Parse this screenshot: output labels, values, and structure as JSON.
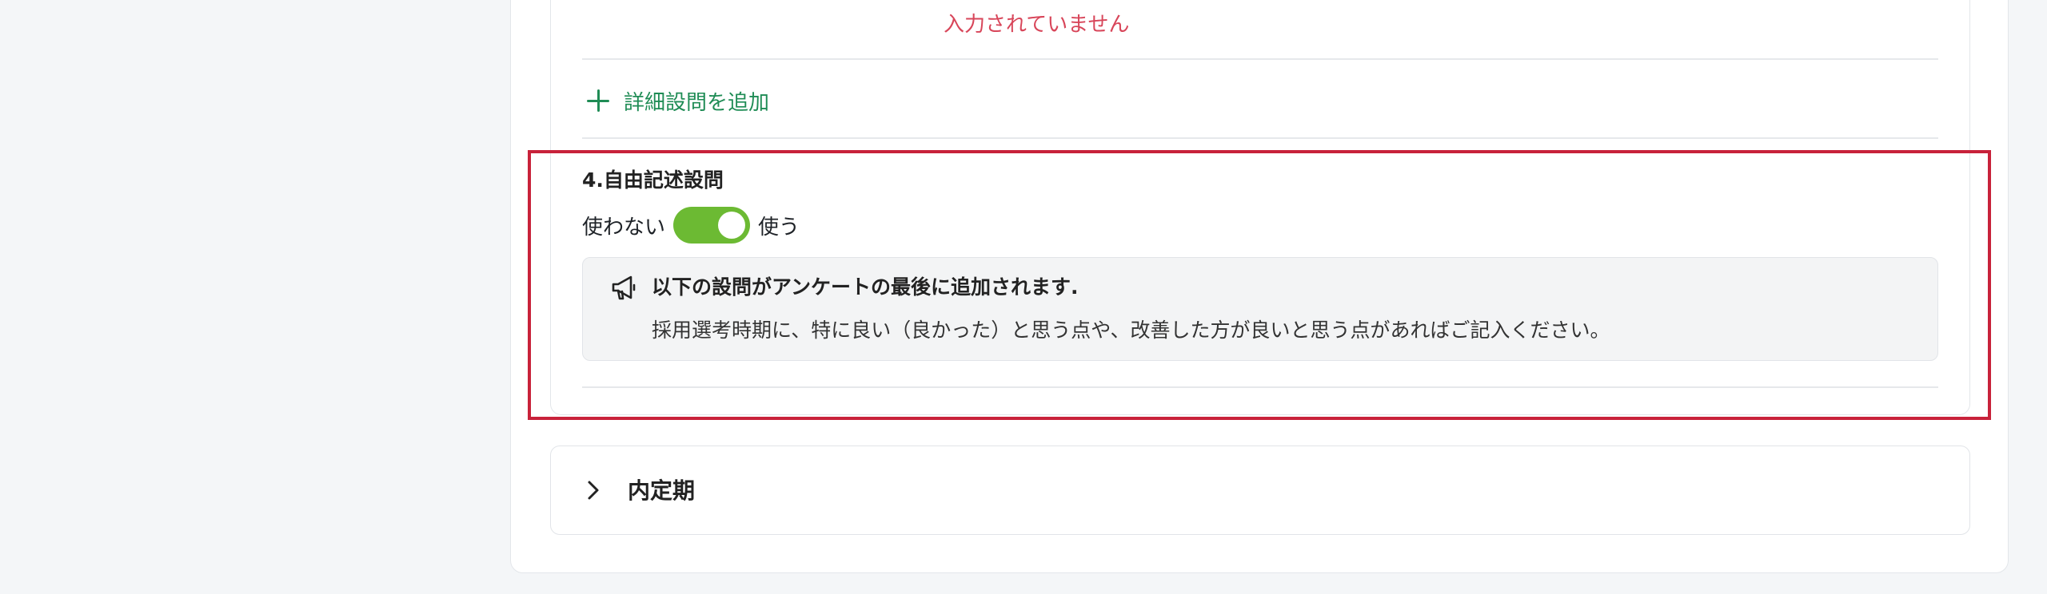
{
  "question3": {
    "error_text": "入力されていません",
    "add_detail_label": "詳細設問を追加"
  },
  "free_text_section": {
    "title": "4.自由記述設問",
    "toggle": {
      "off_label": "使わない",
      "on_label": "使う",
      "state": "on"
    },
    "notice": {
      "icon": "megaphone-icon",
      "title": "以下の設問がアンケートの最後に追加されます.",
      "body": "採用選考時期に、特に良い（良かった）と思う点や、改善した方が良いと思う点があればご記入ください。"
    }
  },
  "accordion": {
    "title": "内定期",
    "expanded": false
  },
  "colors": {
    "accent_green": "#1f8c55",
    "toggle_on": "#6cba33",
    "error_red": "#d8465a",
    "highlight_border": "#c8223a"
  }
}
